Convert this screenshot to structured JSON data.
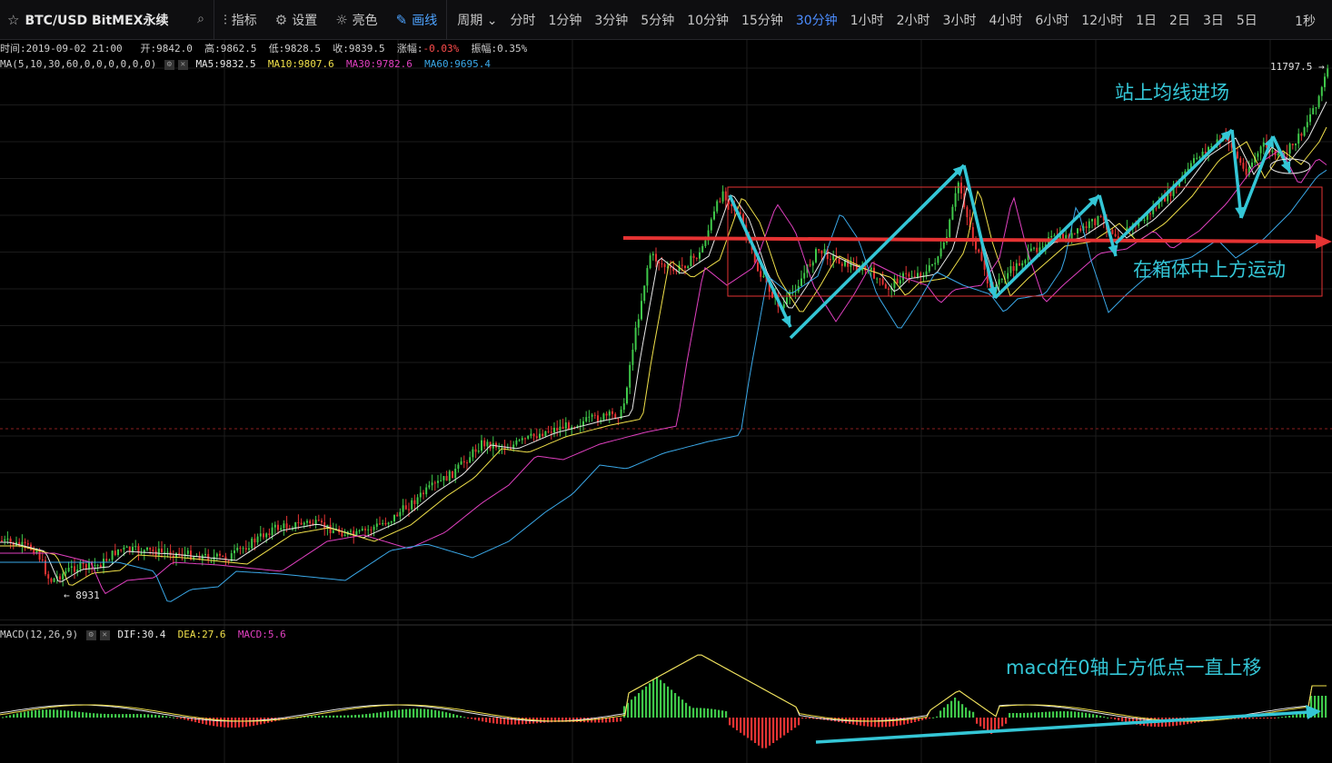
{
  "symbol": {
    "name": "BTC/USD BitMEX永续",
    "star_icon": "star-icon",
    "search_icon": "search-icon"
  },
  "tools": [
    {
      "label": "指标",
      "icon": "indicator-icon"
    },
    {
      "label": "设置",
      "icon": "gear-icon"
    },
    {
      "label": "亮色",
      "icon": "sun-icon"
    },
    {
      "label": "画线",
      "icon": "pencil-icon"
    }
  ],
  "periods": [
    "周期",
    "分时",
    "1分钟",
    "3分钟",
    "5分钟",
    "10分钟",
    "15分钟",
    "30分钟",
    "1小时",
    "2小时",
    "3小时",
    "4小时",
    "6小时",
    "12小时",
    "1日",
    "2日",
    "3日",
    "5日"
  ],
  "active_period": "30分钟",
  "right_label": "1秒",
  "info": {
    "time": "时间:2019-09-02 21:00",
    "open": "开:9842.0",
    "high": "高:9862.5",
    "low": "低:9828.5",
    "close": "收:9839.5",
    "change_label": "涨幅:",
    "change_value": "-0.03%",
    "amplitude": "振幅:0.35%"
  },
  "ma": {
    "params": "MA(5,10,30,60,0,0,0,0,0,0)",
    "ma5": "MA5:9832.5",
    "ma10": "MA10:9807.6",
    "ma30": "MA30:9782.6",
    "ma60": "MA60:9695.4",
    "colors": {
      "ma5": "#e8e8e8",
      "ma10": "#f0e04a",
      "ma30": "#e040c0",
      "ma60": "#3aa8e8"
    }
  },
  "macd": {
    "params": "MACD(12,26,9)",
    "dif": "DIF:30.4",
    "dea": "DEA:27.6",
    "macd": "MACD:5.6"
  },
  "price_marks": {
    "last": "11797.5 →",
    "low": "← 8931"
  },
  "annotations": {
    "top": "站上均线进场",
    "box": "在箱体中上方运动",
    "macd": "macd在0轴上方低点一直上移"
  },
  "colors": {
    "up": "#3fc84a",
    "down": "#e53333",
    "annotation": "#34c6d6",
    "box": "#e53333",
    "active_tab": "#4c8dff"
  }
}
